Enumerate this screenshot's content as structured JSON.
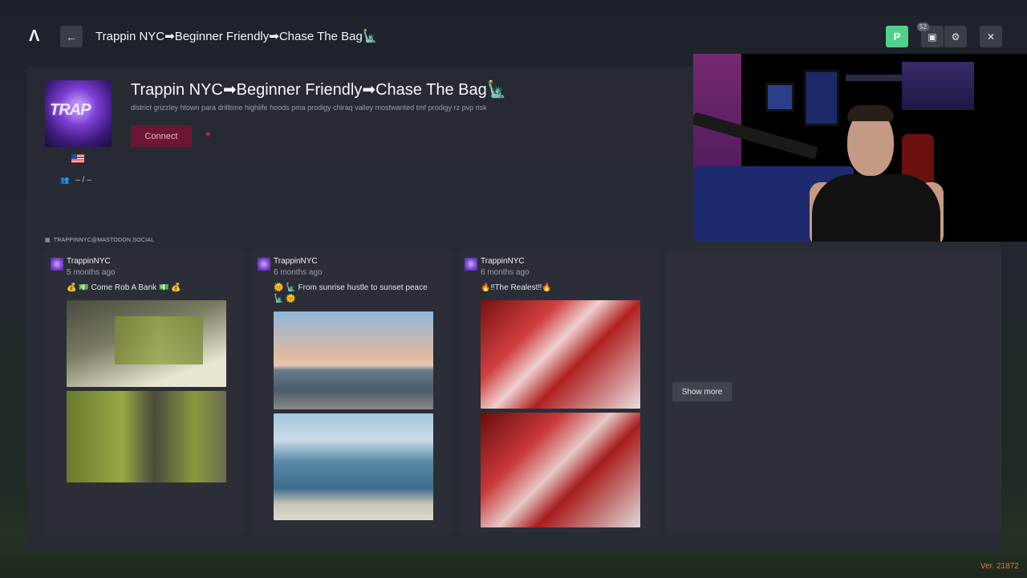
{
  "app": {
    "logo_icon": "fivem-logo-icon",
    "version": "Ver. 21872"
  },
  "topbar": {
    "title": "Trappin NYC➡Beginner Friendly➡Chase The Bag🗽",
    "back_icon": "←",
    "avatar_letter": "P",
    "avatar_color": "#4fd18b",
    "queue_badge": "52",
    "queue_icon": "▣",
    "settings_icon": "⚙",
    "close_icon": "✕"
  },
  "server": {
    "image_text": "TRAP",
    "title": "Trappin NYC➡Beginner Friendly➡Chase The Bag🗽",
    "tags": "district grizzley htown para drilltime highlife hoods pma prodigy chiraq valley mostwanted tmf prodigy rz pvp risk",
    "connect_label": "Connect",
    "favorite_icon": "♥",
    "players_icon": "👥",
    "players_value": "– / –",
    "connect_color": "#6b1634"
  },
  "feed": {
    "handle": "TRAPPINNYC@MASTODON.SOCIAL",
    "posts": [
      {
        "user": "TrappinNYC",
        "time": "5 months ago",
        "text": "💰 💵 Come Rob A Bank 💵 💰"
      },
      {
        "user": "TrappinNYC",
        "time": "6 months ago",
        "text": "🌞 🗽 From sunrise hustle to sunset peace 🗽 🌞"
      },
      {
        "user": "TrappinNYC",
        "time": "6 months ago",
        "text": "🔥‼The Realest‼🔥"
      }
    ],
    "show_more_label": "Show more"
  }
}
